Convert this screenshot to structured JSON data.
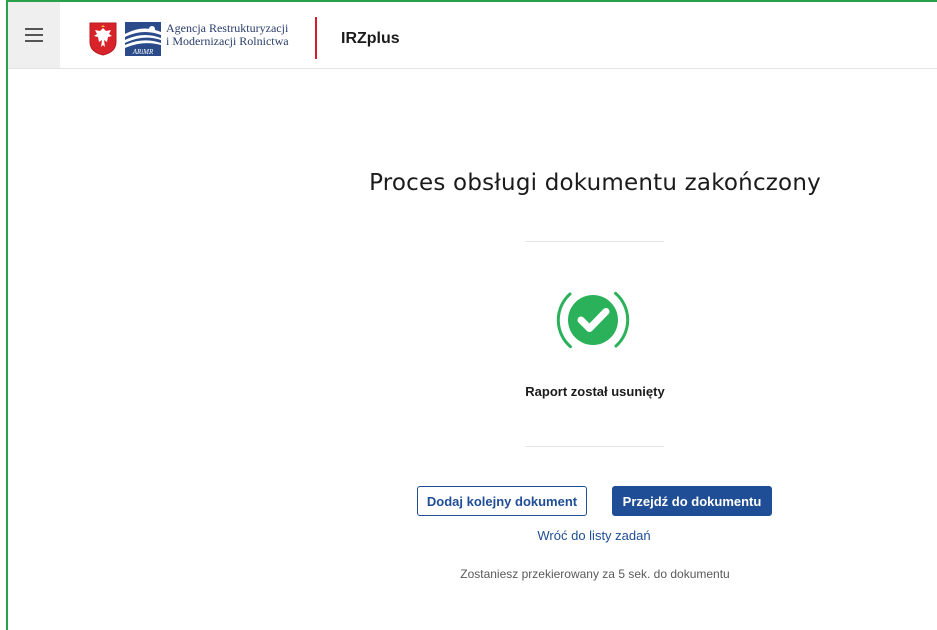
{
  "header": {
    "agency_name_line1": "Agencja Restrukturyzacji",
    "agency_name_line2": "i Modernizacji Rolnictwa",
    "logo_text": "ARiMR",
    "app_title": "IRZplus"
  },
  "main": {
    "title": "Proces obsługi dokumentu zakończony",
    "status_message": "Raport został usunięty",
    "add_document_button": "Dodaj kolejny dokument",
    "go_to_document_button": "Przejdź do dokumentu",
    "back_link": "Wróć do listy zadań",
    "redirect_note": "Zostaniesz przekierowany za 5 sek. do dokumentu"
  },
  "icons": {
    "menu": "hamburger-menu-icon",
    "emblem": "polish-eagle-emblem-icon",
    "logo": "arimr-logo-icon",
    "status": "check-circle-icon"
  },
  "colors": {
    "accent_blue": "#1f4e96",
    "success_green": "#2bb15a",
    "divider_red": "#d21f2b",
    "frame_green": "#2aa04a"
  }
}
